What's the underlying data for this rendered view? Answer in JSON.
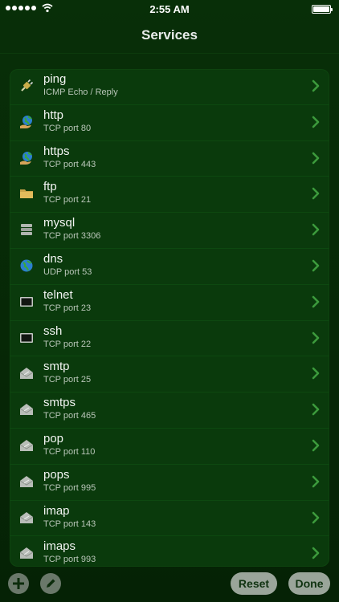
{
  "status": {
    "time": "2:55 AM"
  },
  "nav": {
    "title": "Services"
  },
  "services": [
    {
      "name": "ping",
      "detail": "ICMP Echo / Reply",
      "icon": "plug-icon"
    },
    {
      "name": "http",
      "detail": "TCP port 80",
      "icon": "globe-hand-icon"
    },
    {
      "name": "https",
      "detail": "TCP port 443",
      "icon": "globe-hand-icon"
    },
    {
      "name": "ftp",
      "detail": "TCP port 21",
      "icon": "folder-icon"
    },
    {
      "name": "mysql",
      "detail": "TCP port 3306",
      "icon": "database-icon"
    },
    {
      "name": "dns",
      "detail": "UDP port 53",
      "icon": "globe-icon"
    },
    {
      "name": "telnet",
      "detail": "TCP port 23",
      "icon": "terminal-icon"
    },
    {
      "name": "ssh",
      "detail": "TCP port 22",
      "icon": "terminal-icon"
    },
    {
      "name": "smtp",
      "detail": "TCP port 25",
      "icon": "mail-icon"
    },
    {
      "name": "smtps",
      "detail": "TCP port 465",
      "icon": "mail-icon"
    },
    {
      "name": "pop",
      "detail": "TCP port 110",
      "icon": "mail-icon"
    },
    {
      "name": "pops",
      "detail": "TCP port 995",
      "icon": "mail-icon"
    },
    {
      "name": "imap",
      "detail": "TCP port 143",
      "icon": "mail-icon"
    },
    {
      "name": "imaps",
      "detail": "TCP port 993",
      "icon": "mail-icon"
    }
  ],
  "toolbar": {
    "reset_label": "Reset",
    "done_label": "Done"
  },
  "colors": {
    "background": "#062a06",
    "list_bg": "#0a3a0c",
    "chevron": "#3c9a3c"
  }
}
